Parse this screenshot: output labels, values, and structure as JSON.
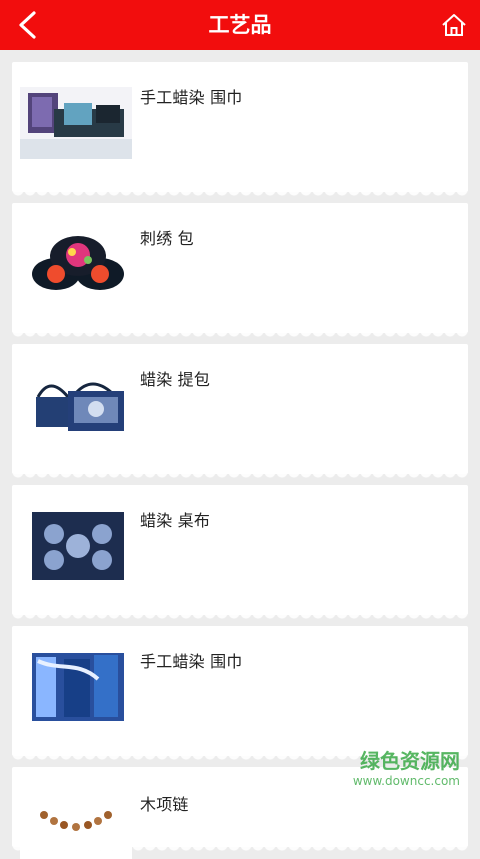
{
  "header": {
    "title": "工艺品",
    "back_icon": "chevron-left-icon",
    "home_icon": "home-icon"
  },
  "items": [
    {
      "label": "手工蜡染 围巾",
      "thumb": "scarf-image"
    },
    {
      "label": "刺绣 包",
      "thumb": "embroidered-bag-image"
    },
    {
      "label": "蜡染 提包",
      "thumb": "batik-handbag-image"
    },
    {
      "label": "蜡染 桌布",
      "thumb": "batik-tablecloth-image"
    },
    {
      "label": "手工蜡染 围巾",
      "thumb": "batik-scarf-image"
    },
    {
      "label": "木项链",
      "thumb": "wooden-necklace-image"
    }
  ],
  "watermark": {
    "title": "绿色资源网",
    "url": "www.downcc.com"
  },
  "colors": {
    "header_bg": "#f20d0d",
    "background": "#ececec"
  }
}
